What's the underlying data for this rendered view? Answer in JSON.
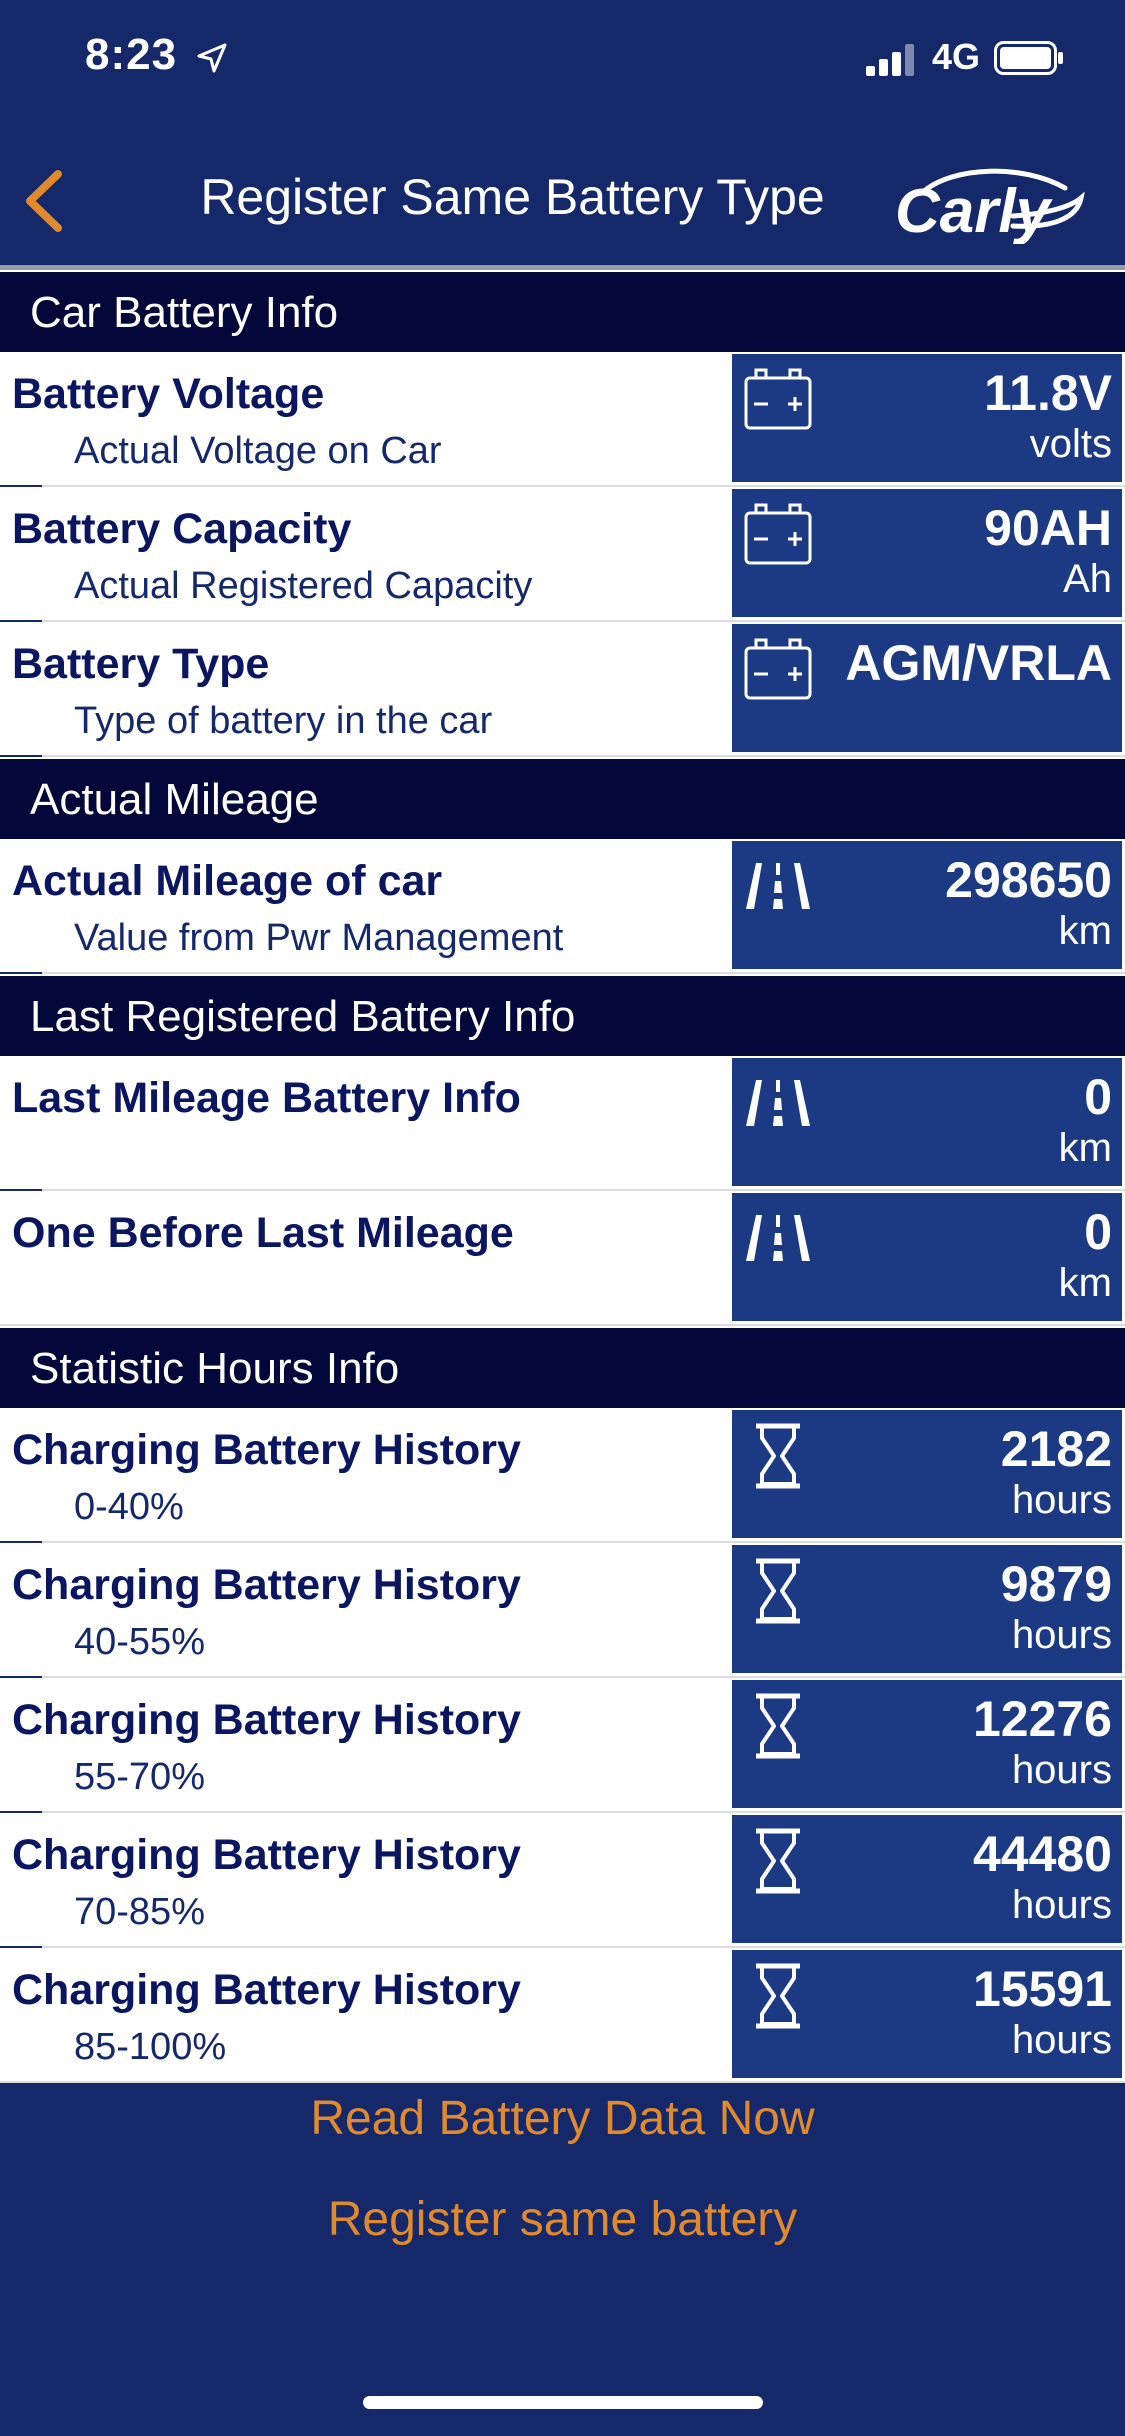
{
  "status": {
    "time": "8:23",
    "network": "4G"
  },
  "nav": {
    "title": "Register Same Battery Type",
    "logo": "Carly"
  },
  "sections": {
    "car_battery": {
      "header": "Car Battery Info"
    },
    "mileage": {
      "header": "Actual Mileage"
    },
    "last_registered": {
      "header": "Last Registered Battery Info"
    },
    "statistics": {
      "header": "Statistic Hours Info"
    }
  },
  "rows": {
    "voltage": {
      "title": "Battery Voltage",
      "sub": "Actual Voltage on Car",
      "value": "11.8V",
      "unit": "volts",
      "icon": "battery-icon"
    },
    "capacity": {
      "title": "Battery Capacity",
      "sub": "Actual Registered Capacity",
      "value": "90AH",
      "unit": "Ah",
      "icon": "battery-icon"
    },
    "type": {
      "title": "Battery Type",
      "sub": "Type of battery in the car",
      "value": "AGM/VRLA",
      "unit": "",
      "icon": "battery-icon"
    },
    "mileage": {
      "title": "Actual Mileage of car",
      "sub": "Value from Pwr Management",
      "value": "298650",
      "unit": "km",
      "icon": "road-icon"
    },
    "last_mileage": {
      "title": "Last Mileage Battery Info",
      "sub": "",
      "value": "0",
      "unit": "km",
      "icon": "road-icon"
    },
    "before_last": {
      "title": "One Before Last Mileage",
      "sub": "",
      "value": "0",
      "unit": "km",
      "icon": "road-icon"
    },
    "charge_0_40": {
      "title": "Charging Battery History",
      "sub": "0-40%",
      "value": "2182",
      "unit": "hours",
      "icon": "hourglass-icon"
    },
    "charge_40_55": {
      "title": "Charging Battery History",
      "sub": "40-55%",
      "value": "9879",
      "unit": "hours",
      "icon": "hourglass-icon"
    },
    "charge_55_70": {
      "title": "Charging Battery History",
      "sub": "55-70%",
      "value": "12276",
      "unit": "hours",
      "icon": "hourglass-icon"
    },
    "charge_70_85": {
      "title": "Charging Battery History",
      "sub": "70-85%",
      "value": "44480",
      "unit": "hours",
      "icon": "hourglass-icon"
    },
    "charge_85_100": {
      "title": "Charging Battery History",
      "sub": "85-100%",
      "value": "15591",
      "unit": "hours",
      "icon": "hourglass-icon"
    }
  },
  "actions": {
    "read": "Read Battery Data Now",
    "register": "Register same battery"
  },
  "colors": {
    "background": "#14286a",
    "section_header": "#040739",
    "value_box": "#1c3a83",
    "accent": "#e0892d"
  }
}
